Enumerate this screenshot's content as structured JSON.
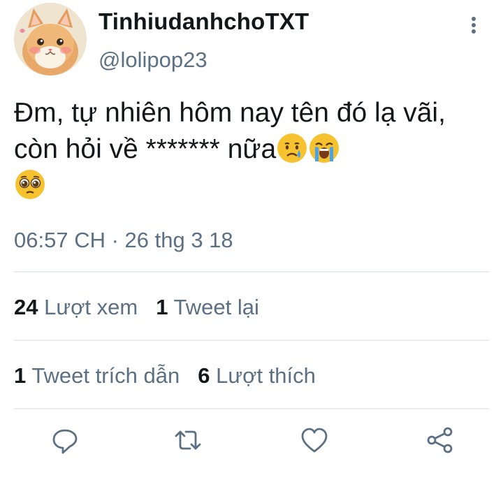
{
  "author": {
    "display_name": "TinhiudanhchoTXT",
    "handle": "@lolipop23"
  },
  "tweet": {
    "text": "Đm, tự nhiên hôm nay tên đó lạ vãi, còn hỏi về ******* nữa",
    "emoji_icons": [
      "crying-face-icon",
      "loudly-crying-face-icon",
      "pleading-face-icon"
    ]
  },
  "meta": {
    "timestamp": "06:57 CH · 26 thg 3 18"
  },
  "stats": {
    "views_count": "24",
    "views_label": "Lượt xem",
    "retweets_count": "1",
    "retweets_label": "Tweet lại",
    "quotes_count": "1",
    "quotes_label": "Tweet trích dẫn",
    "likes_count": "6",
    "likes_label": "Lượt thích"
  },
  "colors": {
    "text_primary": "#14171a",
    "text_secondary": "#5b7083",
    "divider": "#e6ecf0",
    "emoji_yellow": "#f7c22f",
    "tear_blue": "#4aa3e8"
  },
  "action_icons": [
    "reply-icon",
    "retweet-icon",
    "like-icon",
    "share-icon"
  ]
}
